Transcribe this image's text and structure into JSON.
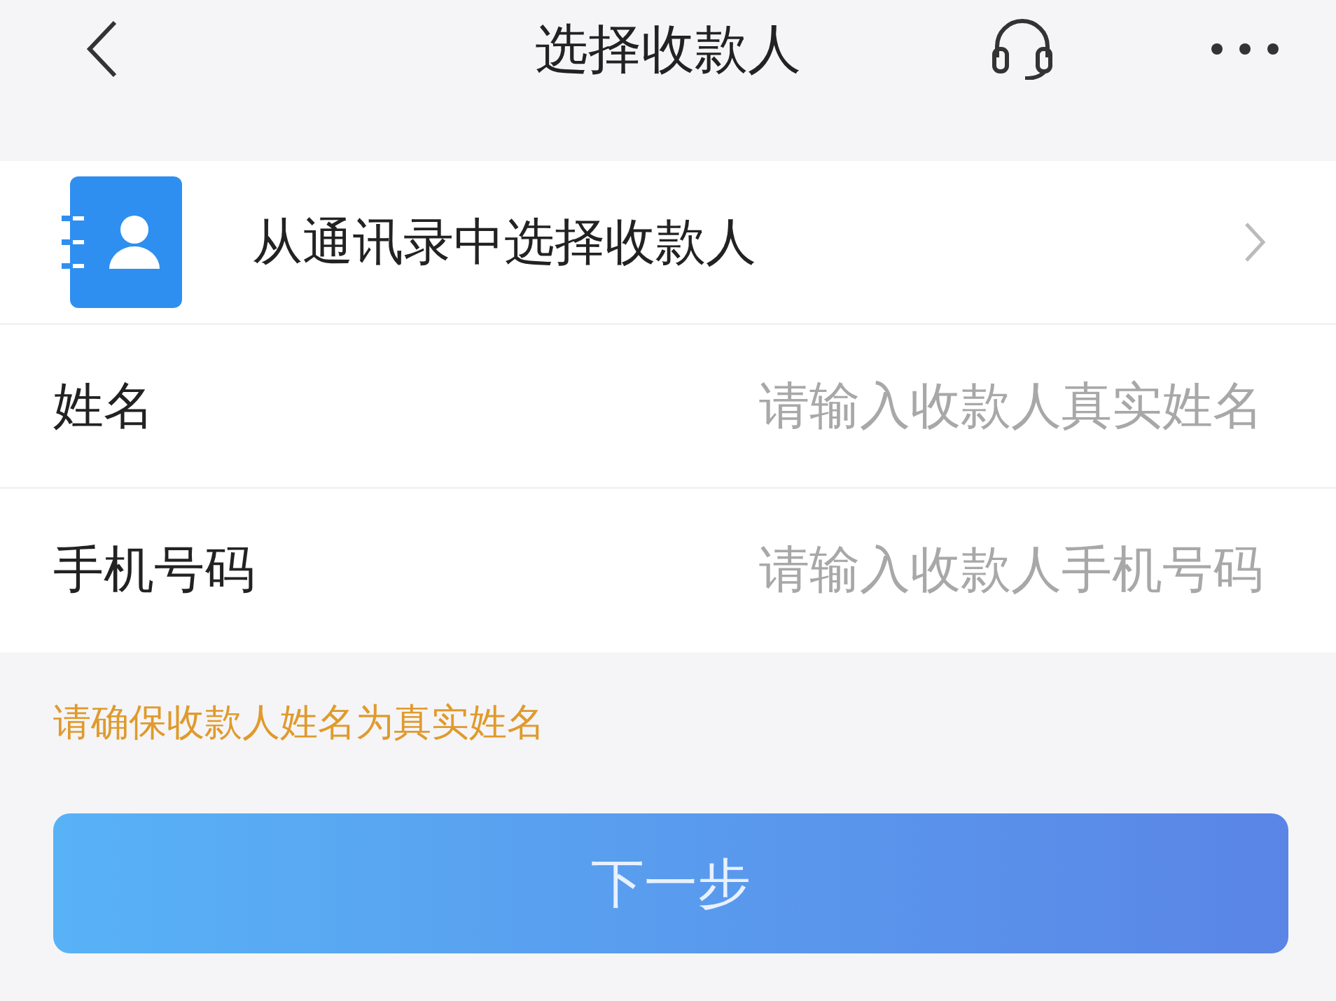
{
  "header": {
    "title": "选择收款人"
  },
  "contacts_link": {
    "label": "从通讯录中选择收款人"
  },
  "fields": [
    {
      "label": "姓名",
      "placeholder": "请输入收款人真实姓名"
    },
    {
      "label": "手机号码",
      "placeholder": "请输入收款人手机号码"
    }
  ],
  "notice": "请确保收款人姓名为真实姓名",
  "button": "下一步"
}
